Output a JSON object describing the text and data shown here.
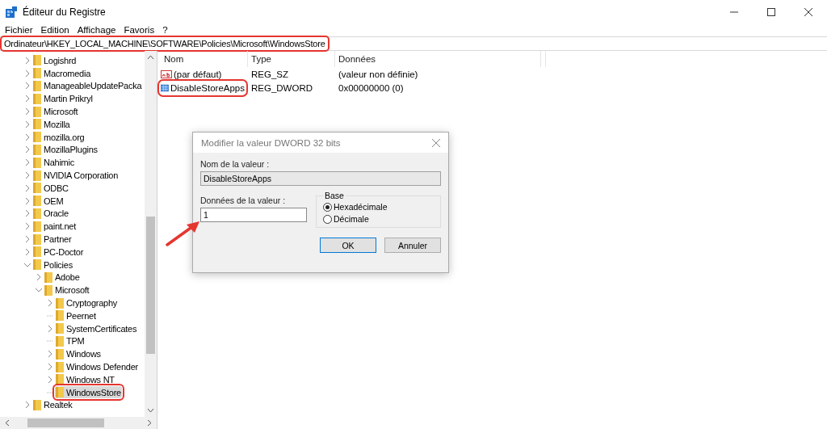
{
  "window": {
    "title": "Éditeur du Registre"
  },
  "menu": [
    "Fichier",
    "Edition",
    "Affichage",
    "Favoris",
    "?"
  ],
  "address": {
    "value": "Ordinateur\\HKEY_LOCAL_MACHINE\\SOFTWARE\\Policies\\Microsoft\\WindowsStore",
    "highlighted": true
  },
  "tree": [
    {
      "label": "Logishrd",
      "kind": "branch",
      "expanded": false,
      "selected": false,
      "highlighted": false
    },
    {
      "label": "Macromedia",
      "kind": "branch",
      "expanded": false,
      "selected": false,
      "highlighted": false
    },
    {
      "label": "ManageableUpdatePacka",
      "kind": "branch",
      "expanded": false,
      "selected": false,
      "highlighted": false
    },
    {
      "label": "Martin Prikryl",
      "kind": "branch",
      "expanded": false,
      "selected": false,
      "highlighted": false
    },
    {
      "label": "Microsoft",
      "kind": "branch",
      "expanded": false,
      "selected": false,
      "highlighted": false
    },
    {
      "label": "Mozilla",
      "kind": "branch",
      "expanded": false,
      "selected": false,
      "highlighted": false
    },
    {
      "label": "mozilla.org",
      "kind": "branch",
      "expanded": false,
      "selected": false,
      "highlighted": false
    },
    {
      "label": "MozillaPlugins",
      "kind": "branch",
      "expanded": false,
      "selected": false,
      "highlighted": false
    },
    {
      "label": "Nahimic",
      "kind": "branch",
      "expanded": false,
      "selected": false,
      "highlighted": false
    },
    {
      "label": "NVIDIA Corporation",
      "kind": "branch",
      "expanded": false,
      "selected": false,
      "highlighted": false
    },
    {
      "label": "ODBC",
      "kind": "branch",
      "expanded": false,
      "selected": false,
      "highlighted": false
    },
    {
      "label": "OEM",
      "kind": "branch",
      "expanded": false,
      "selected": false,
      "highlighted": false
    },
    {
      "label": "Oracle",
      "kind": "branch",
      "expanded": false,
      "selected": false,
      "highlighted": false
    },
    {
      "label": "paint.net",
      "kind": "branch",
      "expanded": false,
      "selected": false,
      "highlighted": false
    },
    {
      "label": "Partner",
      "kind": "branch",
      "expanded": false,
      "selected": false,
      "highlighted": false
    },
    {
      "label": "PC-Doctor",
      "kind": "branch",
      "expanded": false,
      "selected": false,
      "highlighted": false
    },
    {
      "label": "Policies",
      "kind": "branch",
      "expanded": true,
      "selected": false,
      "highlighted": false,
      "children": [
        {
          "label": "Adobe",
          "kind": "branch",
          "expanded": false,
          "selected": false,
          "highlighted": false
        },
        {
          "label": "Microsoft",
          "kind": "branch",
          "expanded": true,
          "selected": false,
          "highlighted": false,
          "children": [
            {
              "label": "Cryptography",
              "kind": "branch",
              "expanded": false,
              "selected": false,
              "highlighted": false
            },
            {
              "label": "Peernet",
              "kind": "leaf",
              "selected": false,
              "highlighted": false
            },
            {
              "label": "SystemCertificates",
              "kind": "branch",
              "expanded": false,
              "selected": false,
              "highlighted": false
            },
            {
              "label": "TPM",
              "kind": "leaf",
              "selected": false,
              "highlighted": false
            },
            {
              "label": "Windows",
              "kind": "branch",
              "expanded": false,
              "selected": false,
              "highlighted": false
            },
            {
              "label": "Windows Defender",
              "kind": "branch",
              "expanded": false,
              "selected": false,
              "highlighted": false
            },
            {
              "label": "Windows NT",
              "kind": "branch",
              "expanded": false,
              "selected": false,
              "highlighted": false
            },
            {
              "label": "WindowsStore",
              "kind": "leaf",
              "selected": true,
              "highlighted": true
            }
          ]
        }
      ]
    },
    {
      "label": "Realtek",
      "kind": "branch",
      "expanded": false,
      "selected": false,
      "highlighted": false
    }
  ],
  "values": {
    "columns": [
      "Nom",
      "Type",
      "Données"
    ],
    "rows": [
      {
        "kind": "string",
        "name": "(par défaut)",
        "type": "REG_SZ",
        "data": "(valeur non définie)",
        "highlighted": false
      },
      {
        "kind": "binary",
        "name": "DisableStoreApps",
        "type": "REG_DWORD",
        "data": "0x00000000 (0)",
        "highlighted": true
      }
    ]
  },
  "dialog": {
    "title": "Modifier la valeur DWORD 32 bits",
    "name_label": "Nom de la valeur :",
    "name_value": "DisableStoreApps",
    "data_label": "Données de la valeur :",
    "data_value": "1",
    "base_label": "Base",
    "bases": [
      {
        "label": "Hexadécimale",
        "selected": true
      },
      {
        "label": "Décimale",
        "selected": false
      }
    ],
    "buttons": [
      "OK",
      "Annuler"
    ]
  }
}
